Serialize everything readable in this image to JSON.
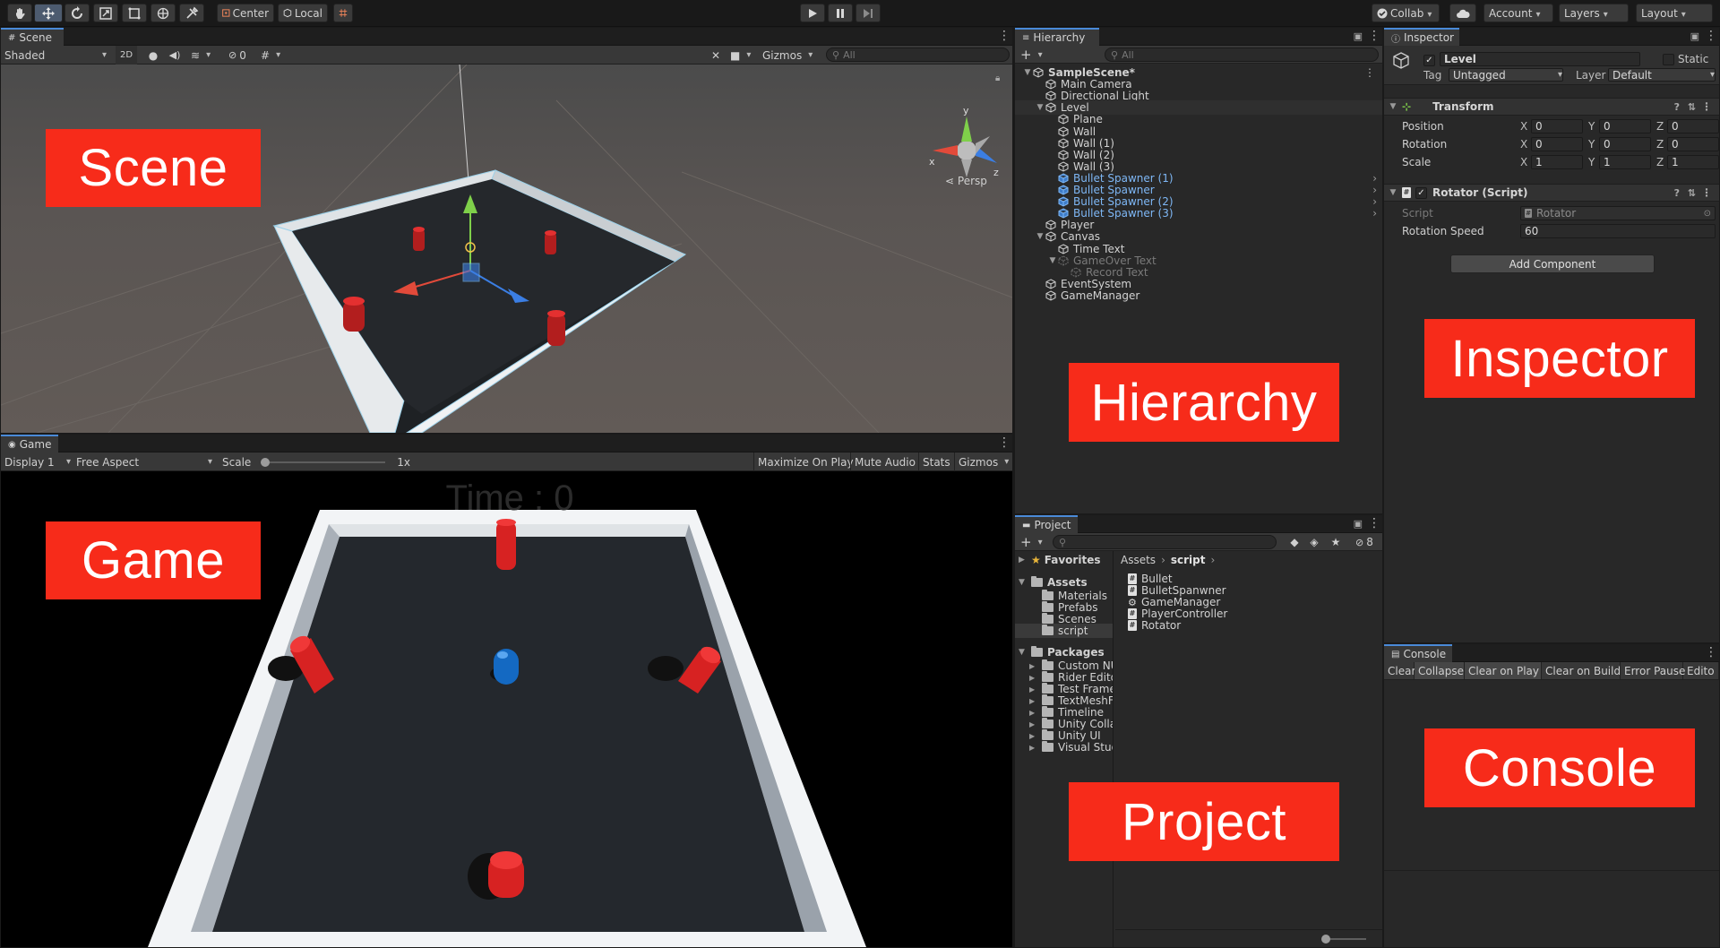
{
  "toolbar": {
    "pivot_label": "Center",
    "space_label": "Local",
    "collab_label": "Collab",
    "account_label": "Account",
    "layers_label": "Layers",
    "layout_label": "Layout"
  },
  "scene": {
    "tab_label": "Scene",
    "shading_label": "Shaded",
    "mode_2d_label": "2D",
    "hidden_count": "0",
    "gizmos_label": "Gizmos",
    "search_placeholder": "All",
    "persp_label": "Persp",
    "overlay_label": "Scene"
  },
  "game": {
    "tab_label": "Game",
    "display_label": "Display 1",
    "aspect_label": "Free Aspect",
    "scale_label": "Scale",
    "scale_value": "1x",
    "scale_fraction": 0.0,
    "maximize_label": "Maximize On Play",
    "mute_label": "Mute Audio",
    "stats_label": "Stats",
    "gizmos_label": "Gizmos",
    "hud_time": "Time : 0",
    "overlay_label": "Game"
  },
  "hierarchy": {
    "tab_label": "Hierarchy",
    "search_placeholder": "All",
    "overlay_label": "Hierarchy",
    "items": [
      {
        "label": "SampleScene*",
        "depth": 0,
        "kind": "scene",
        "expanded": true
      },
      {
        "label": "Main Camera",
        "depth": 1,
        "kind": "object"
      },
      {
        "label": "Directional Light",
        "depth": 1,
        "kind": "object"
      },
      {
        "label": "Level",
        "depth": 1,
        "kind": "object",
        "expanded": true,
        "selected": true
      },
      {
        "label": "Plane",
        "depth": 2,
        "kind": "object"
      },
      {
        "label": "Wall",
        "depth": 2,
        "kind": "object"
      },
      {
        "label": "Wall (1)",
        "depth": 2,
        "kind": "object"
      },
      {
        "label": "Wall (2)",
        "depth": 2,
        "kind": "object"
      },
      {
        "label": "Wall (3)",
        "depth": 2,
        "kind": "object"
      },
      {
        "label": "Bullet Spawner (1)",
        "depth": 2,
        "kind": "prefab"
      },
      {
        "label": "Bullet Spawner",
        "depth": 2,
        "kind": "prefab"
      },
      {
        "label": "Bullet Spawner (2)",
        "depth": 2,
        "kind": "prefab"
      },
      {
        "label": "Bullet Spawner (3)",
        "depth": 2,
        "kind": "prefab"
      },
      {
        "label": "Player",
        "depth": 1,
        "kind": "object"
      },
      {
        "label": "Canvas",
        "depth": 1,
        "kind": "object",
        "expanded": true
      },
      {
        "label": "Time Text",
        "depth": 2,
        "kind": "object"
      },
      {
        "label": "GameOver Text",
        "depth": 2,
        "kind": "disabled",
        "expanded": true
      },
      {
        "label": "Record Text",
        "depth": 3,
        "kind": "disabled"
      },
      {
        "label": "EventSystem",
        "depth": 1,
        "kind": "object"
      },
      {
        "label": "GameManager",
        "depth": 1,
        "kind": "object"
      }
    ]
  },
  "inspector": {
    "tab_label": "Inspector",
    "object_name": "Level",
    "static_label": "Static",
    "tag_label": "Tag",
    "tag_value": "Untagged",
    "layer_label": "Layer",
    "layer_value": "Default",
    "transform": {
      "title": "Transform",
      "rows": [
        {
          "label": "Position",
          "x": "0",
          "y": "0",
          "z": "0"
        },
        {
          "label": "Rotation",
          "x": "0",
          "y": "0",
          "z": "0"
        },
        {
          "label": "Scale",
          "x": "1",
          "y": "1",
          "z": "1"
        }
      ],
      "axis_x": "X",
      "axis_y": "Y",
      "axis_z": "Z"
    },
    "rotator": {
      "title": "Rotator (Script)",
      "script_label": "Script",
      "script_value": "Rotator",
      "speed_label": "Rotation Speed",
      "speed_value": "60"
    },
    "add_component_label": "Add Component",
    "overlay_label": "Inspector"
  },
  "project": {
    "tab_label": "Project",
    "hidden_count": "8",
    "overlay_label": "Project",
    "favorites_label": "Favorites",
    "assets_label": "Assets",
    "asset_folders": [
      "Materials",
      "Prefabs",
      "Scenes",
      "script"
    ],
    "packages_label": "Packages",
    "package_folders": [
      "Custom NU",
      "Rider Edito",
      "Test Frame",
      "TextMeshF",
      "Timeline",
      "Unity Colla",
      "Unity UI",
      "Visual Stud"
    ],
    "breadcrumb": [
      "Assets",
      "script"
    ],
    "files": [
      {
        "label": "Bullet",
        "kind": "script"
      },
      {
        "label": "BulletSpanwner",
        "kind": "script"
      },
      {
        "label": "GameManager",
        "kind": "gear"
      },
      {
        "label": "PlayerController",
        "kind": "script"
      },
      {
        "label": "Rotator",
        "kind": "script"
      }
    ]
  },
  "console": {
    "tab_label": "Console",
    "buttons": [
      "Clear",
      "Collapse",
      "Clear on Play",
      "Clear on Build",
      "Error Pause",
      "Edito"
    ],
    "overlay_label": "Console"
  },
  "colors": {
    "label_red": "#f72b1a",
    "prefab_blue": "#7eb7f5",
    "selection": "#2f2f2f",
    "tab_accent": "#4a8ad8"
  }
}
